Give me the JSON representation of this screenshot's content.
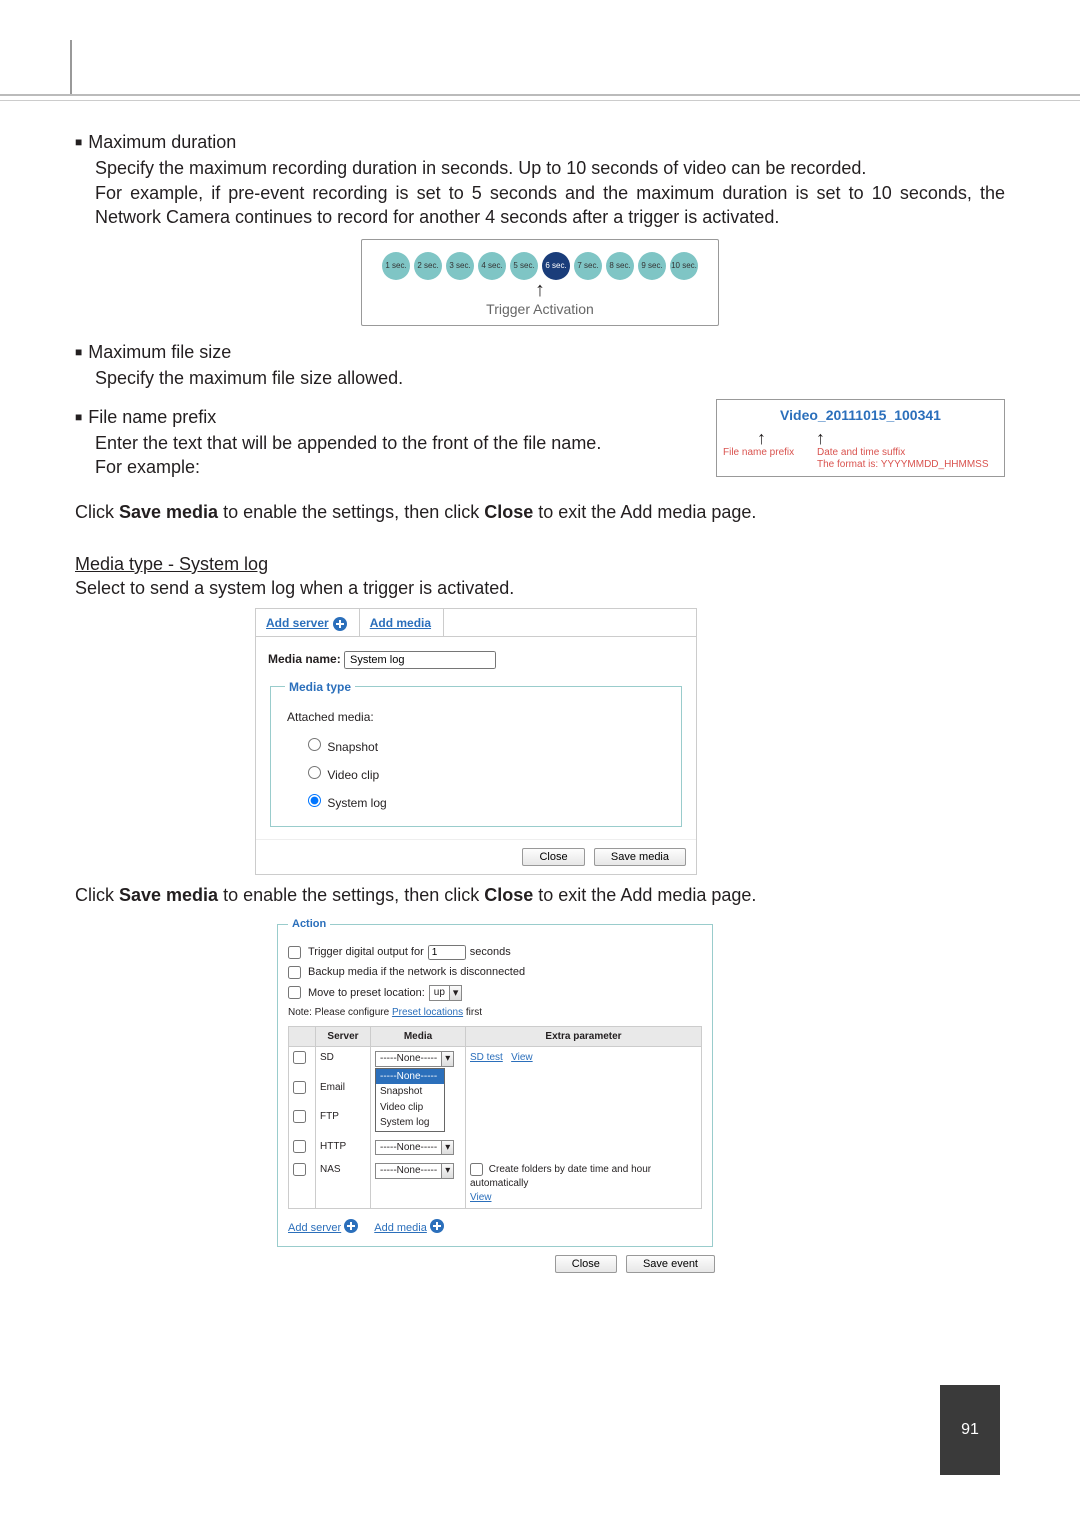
{
  "pageNumber": "91",
  "sec_maxdur": {
    "title": "Maximum duration",
    "p1": "Specify the maximum recording duration in seconds. Up to 10 seconds of video can be recorded.",
    "p2": "For example, if pre-event recording is set to 5 seconds and the maximum duration is set to 10 seconds, the Network Camera continues to record for another 4 seconds after a trigger is activated."
  },
  "timeline": {
    "dots": [
      "1 sec.",
      "2 sec.",
      "3 sec.",
      "4 sec.",
      "5 sec.",
      "6 sec.",
      "7 sec.",
      "8 sec.",
      "9 sec.",
      "10 sec."
    ],
    "activeIndex": 5,
    "label": "Trigger Activation"
  },
  "sec_maxfs": {
    "title": "Maximum file size",
    "p": "Specify the maximum file size allowed."
  },
  "sec_prefix": {
    "title": "File name prefix",
    "p1": "Enter the text that will be appended to the front of the file name.",
    "p2": "For example:"
  },
  "filename_box": {
    "sample": "Video_20111015_100341",
    "label1": "File name prefix",
    "label2a": "Date and time suffix",
    "label2b": "The format is: YYYYMMDD_HHMMSS"
  },
  "instruction": {
    "pre": "Click ",
    "b1": "Save media",
    "mid": " to enable the settings, then click ",
    "b2": "Close",
    "post": " to exit the Add media page."
  },
  "syslog": {
    "title": "Media type - System log",
    "p": "Select to send a system log when a trigger is activated."
  },
  "panel_media": {
    "tabs": {
      "addServer": "Add server",
      "addMedia": "Add media"
    },
    "mediaNameLabel": "Media name:",
    "mediaNameValue": "System log",
    "legend": "Media type",
    "attached": "Attached media:",
    "radios": {
      "snapshot": "Snapshot",
      "videoclip": "Video clip",
      "systemlog": "System log"
    },
    "selected": "systemlog",
    "buttons": {
      "close": "Close",
      "save": "Save media"
    }
  },
  "panel_action": {
    "legend": "Action",
    "rows": {
      "trigger_pre": "Trigger digital output for",
      "trigger_val": "1",
      "trigger_post": "seconds",
      "backup": "Backup media if the network is disconnected",
      "move_pre": "Move to preset location:",
      "move_val": "up",
      "note_pre": "Note: Please configure ",
      "note_link": "Preset locations",
      "note_post": " first"
    },
    "tableHeaders": {
      "server": "Server",
      "media": "Media",
      "extra": "Extra parameter"
    },
    "servers": {
      "sd": {
        "label": "SD",
        "sel": "-----None-----",
        "extra_sd1": "SD test",
        "extra_sd2": "View"
      },
      "email": {
        "label": "Email"
      },
      "ftp": {
        "label": "FTP"
      },
      "http": {
        "label": "HTTP",
        "sel": "-----None-----"
      },
      "nas": {
        "label": "NAS",
        "sel": "-----None-----",
        "extra_chk": "Create folders by date time and hour automatically",
        "extra_view": "View"
      }
    },
    "dropdown_open": {
      "none": "-----None-----",
      "opt1": "Snapshot",
      "opt2": "Video clip",
      "opt3": "System log"
    },
    "addrow": {
      "addServer": "Add server",
      "addMedia": "Add media"
    },
    "buttons": {
      "close": "Close",
      "save": "Save event"
    }
  }
}
